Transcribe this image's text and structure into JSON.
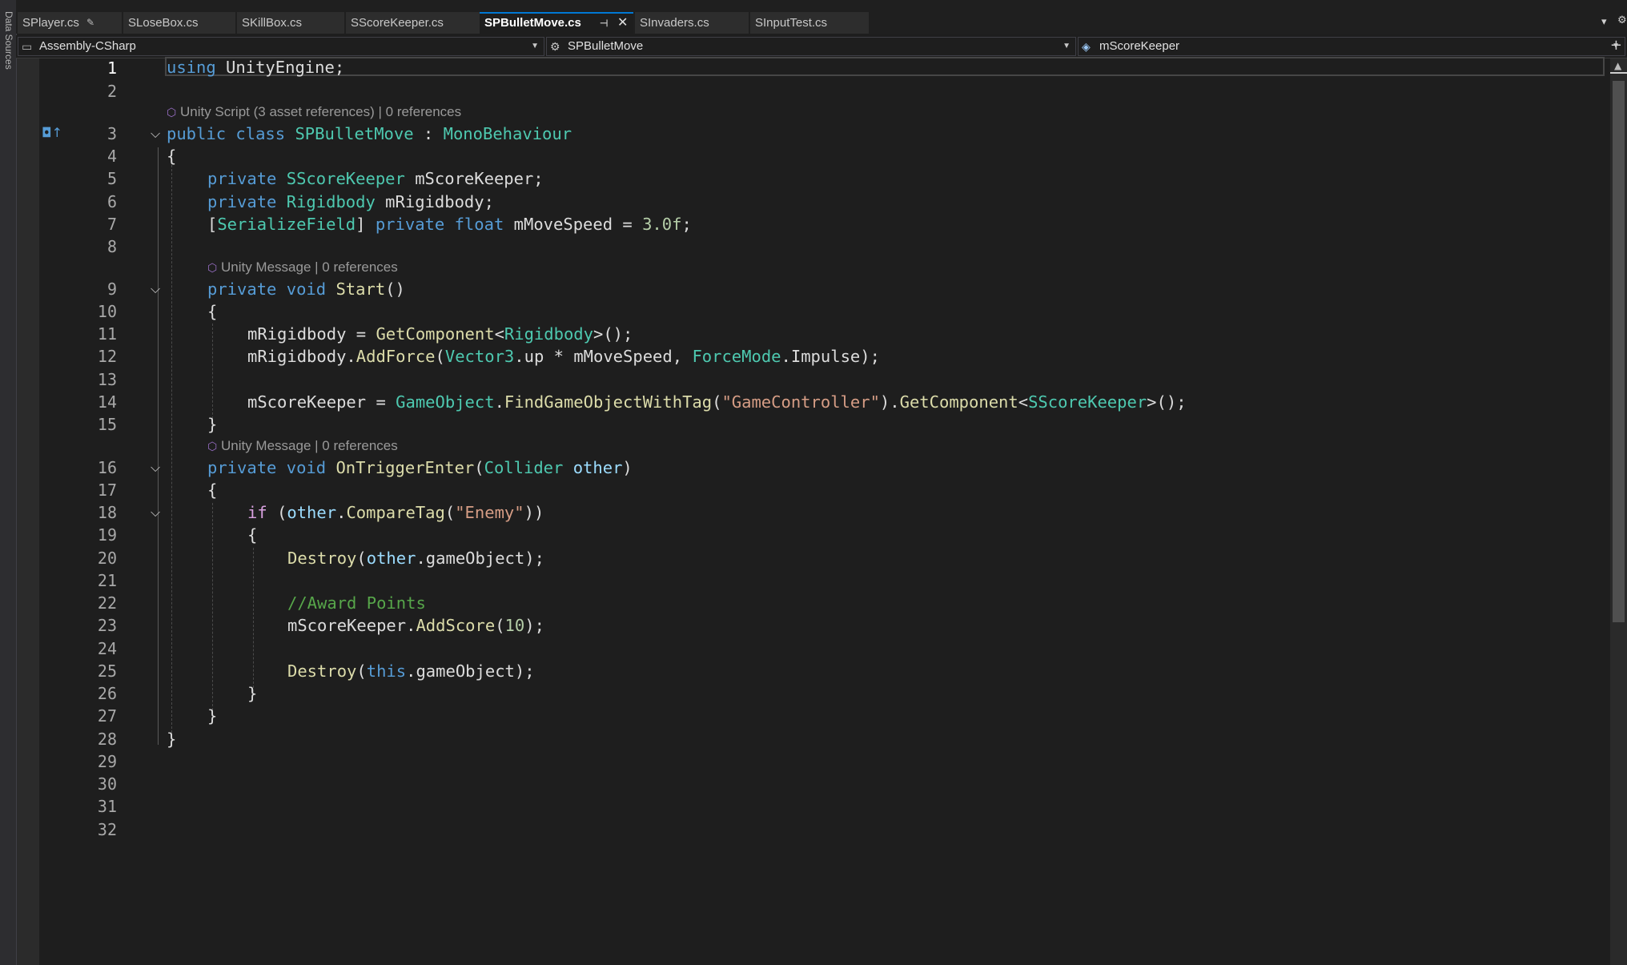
{
  "side_panel": {
    "label": "Data Sources"
  },
  "tabs": [
    {
      "label": "SPlayer.cs",
      "pinned": true
    },
    {
      "label": "SLoseBox.cs"
    },
    {
      "label": "SKillBox.cs"
    },
    {
      "label": "SScoreKeeper.cs"
    },
    {
      "label": "SPBulletMove.cs",
      "active": true,
      "pinned": true,
      "close": "✕"
    },
    {
      "label": "SInvaders.cs"
    },
    {
      "label": "SInputTest.cs"
    }
  ],
  "tabbar_icons": {
    "dropdown": "chevron-down",
    "settings": "gear"
  },
  "navbar": {
    "project": "Assembly-CSharp",
    "type": "SPBulletMove",
    "member": "mScoreKeeper",
    "split_icon": "+"
  },
  "editor": {
    "current_line": 1,
    "line_numbers": [
      "1",
      "2",
      "3",
      "4",
      "5",
      "6",
      "7",
      "8",
      "9",
      "10",
      "11",
      "12",
      "13",
      "14",
      "15",
      "16",
      "17",
      "18",
      "19",
      "20",
      "21",
      "22",
      "23",
      "24",
      "25",
      "26",
      "27",
      "28",
      "29",
      "30",
      "31",
      "32"
    ],
    "codelens": {
      "class_lens": "Unity Script (3 asset references) | 0 references",
      "start_lens": "Unity Message | 0 references",
      "trigger_lens": "Unity Message | 0 references"
    },
    "margin_glyph": "implements-icon",
    "code": {
      "l1": [
        "using",
        " UnityEngine;"
      ],
      "l3": [
        "public",
        " ",
        "class",
        " ",
        "SPBulletMove",
        " : ",
        "MonoBehaviour"
      ],
      "l4": "{",
      "l5": [
        "private",
        " ",
        "SScoreKeeper",
        " mScoreKeeper;"
      ],
      "l6": [
        "private",
        " ",
        "Rigidbody",
        " mRigidbody;"
      ],
      "l7": [
        "[",
        "SerializeField",
        "] ",
        "private",
        " ",
        "float",
        " mMoveSpeed = ",
        "3.0f",
        ";"
      ],
      "l9": [
        "private",
        " ",
        "void",
        " ",
        "Start",
        "()"
      ],
      "l10": "{",
      "l11": [
        "mRigidbody = ",
        "GetComponent",
        "<",
        "Rigidbody",
        ">();"
      ],
      "l12": [
        "mRigidbody.",
        "AddForce",
        "(",
        "Vector3",
        ".up * mMoveSpeed, ",
        "ForceMode",
        ".Impulse);"
      ],
      "l14": [
        "mScoreKeeper = ",
        "GameObject",
        ".",
        "FindGameObjectWithTag",
        "(",
        "\"GameController\"",
        ").",
        "GetComponent",
        "<",
        "SScoreKeeper",
        ">();"
      ],
      "l15": "}",
      "l16": [
        "private",
        " ",
        "void",
        " ",
        "OnTriggerEnter",
        "(",
        "Collider",
        " ",
        "other",
        ")"
      ],
      "l17": "{",
      "l18": [
        "if",
        " (",
        "other",
        ".",
        "CompareTag",
        "(",
        "\"Enemy\"",
        "))"
      ],
      "l19": "{",
      "l20": [
        "Destroy",
        "(",
        "other",
        ".gameObject);"
      ],
      "l22": "//Award Points",
      "l23": [
        "mScoreKeeper.",
        "AddScore",
        "(",
        "10",
        ");"
      ],
      "l25": [
        "Destroy",
        "(",
        "this",
        ".gameObject);"
      ],
      "l26": "}",
      "l27": "}",
      "l28": "}"
    }
  },
  "colors": {
    "keyword": "#569cd6",
    "control_keyword": "#d8a0df",
    "type": "#4ec9b0",
    "method": "#dcdcaa",
    "string": "#d69d85",
    "number": "#b5cea8",
    "comment": "#57a64a",
    "parameter": "#9cdcfe",
    "active_tab_accent": "#0078d4"
  }
}
